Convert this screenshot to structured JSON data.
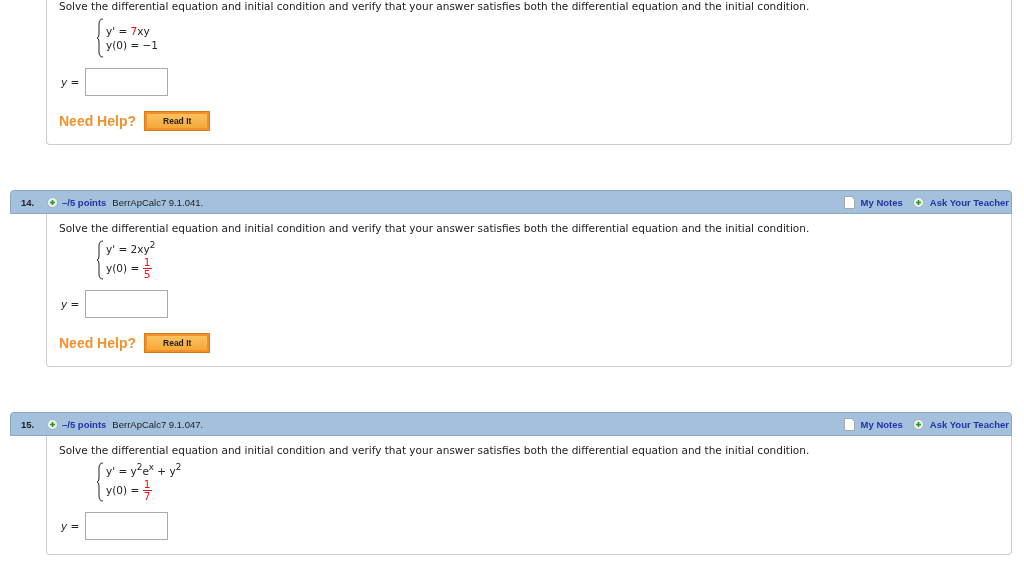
{
  "questions": [
    {
      "prompt": "Solve the differential equation and initial condition and verify that your answer satisfies both the differential equation and the initial condition.",
      "system": [
        [
          {
            "kind": "text",
            "text": "y' = "
          },
          {
            "kind": "text",
            "text": "7",
            "highlight": true
          },
          {
            "kind": "text",
            "text": "xy"
          }
        ],
        [
          {
            "kind": "text",
            "text": "y(0) = −1"
          }
        ]
      ],
      "answer_label": "y =",
      "help_label": "Need Help?",
      "help_buttons": [
        "Read It"
      ]
    },
    {
      "header": {
        "number": "14.",
        "points": "–/5 points",
        "source": "BerrApCalc7 9.1.041.",
        "notes": "My Notes",
        "ask": "Ask Your Teacher"
      },
      "prompt": "Solve the differential equation and initial condition and verify that your answer satisfies both the differential equation and the initial condition.",
      "system": [
        [
          {
            "kind": "text",
            "text": "y' = 2xy$^{2}$"
          }
        ],
        [
          {
            "kind": "text",
            "text": "y(0) = "
          },
          {
            "kind": "fraction",
            "numerator": "1",
            "denominator": "5",
            "highlight": true
          }
        ]
      ],
      "answer_label": "y =",
      "help_label": "Need Help?",
      "help_buttons": [
        "Read It"
      ]
    },
    {
      "header": {
        "number": "15.",
        "points": "–/5 points",
        "source": "BerrApCalc7 9.1.047.",
        "notes": "My Notes",
        "ask": "Ask Your Teacher"
      },
      "prompt": "Solve the differential equation and initial condition and verify that your answer satisfies both the differential equation and the initial condition.",
      "system": [
        [
          {
            "kind": "text",
            "text": "y' = y$^{2}$e$^{x}$ + y$^{2}$"
          }
        ],
        [
          {
            "kind": "text",
            "text": "y(0) = "
          },
          {
            "kind": "fraction",
            "numerator": "1",
            "denominator": "7",
            "highlight": true
          }
        ]
      ],
      "answer_label": "y ="
    }
  ]
}
